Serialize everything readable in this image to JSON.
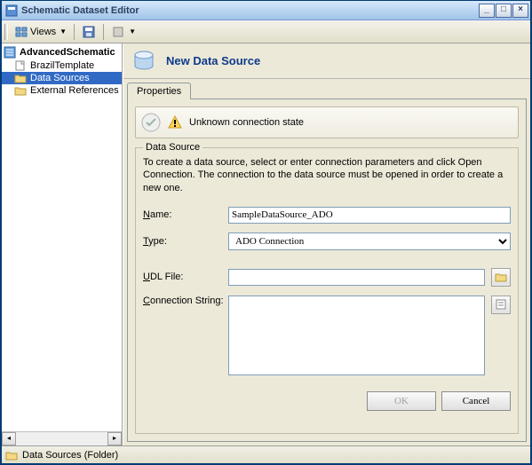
{
  "window": {
    "title": "Schematic Dataset Editor"
  },
  "toolbar": {
    "views": "Views"
  },
  "tree": {
    "root": "AdvancedSchematic",
    "items": [
      {
        "label": "BrazilTemplate"
      },
      {
        "label": "Data Sources"
      },
      {
        "label": "External References"
      }
    ]
  },
  "header": {
    "title": "New Data Source"
  },
  "tabs": {
    "properties": "Properties"
  },
  "status": {
    "text": "Unknown connection state"
  },
  "fieldset": {
    "legend": "Data Source",
    "instruction": "To create a data source, select or enter connection parameters and click Open Connection.  The connection to the data source must be opened in order to create a new one.",
    "name_label": "Name:",
    "name_value": "SampleDataSource_ADO",
    "type_label": "Type:",
    "type_value": "ADO Connection",
    "udl_label": "UDL File:",
    "udl_value": "",
    "conn_label": "Connection String:",
    "conn_value": ""
  },
  "buttons": {
    "ok": "OK",
    "cancel": "Cancel"
  },
  "statusbar": {
    "text": "Data Sources (Folder)"
  }
}
